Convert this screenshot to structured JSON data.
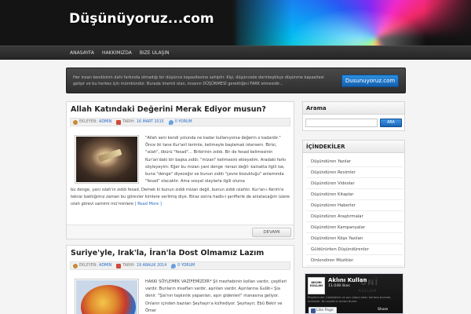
{
  "site": {
    "title": "Düşünüyoruz...com"
  },
  "nav": {
    "items": [
      "ANASAYFA",
      "HAKKIMIZDA",
      "BIZE ULAŞIN"
    ]
  },
  "infobar": {
    "text": "Her insan kendisinin dahi farkında olmadığı bir düşünce kapasitesine sahiptir. Kişi, düşüncede derinleştikçe düşünme kapasitesi gelişir ve bu herkes için mümkündür. Burada önemli olan, insanın DÜŞÜNMESİ gerektiğini FARK etmesidir...",
    "button": "Dusunuyoruz.com"
  },
  "posts": [
    {
      "title": "Allah Katındaki Değerini Merak Ediyor musun?",
      "meta": {
        "author_label": "EKLEYEN:",
        "author": "ADMIN",
        "date_label": "TARIH:",
        "date": "16 MART 2015",
        "comments": "0 YORUM"
      },
      "excerpt_right": "\"Allah seni kendi yolunda ne kadar kullanıyorsa değerin o kadardır.\" Önce iki tane Kur'anî terimle, kelimeyle başlamak istersem. Birisi, \"ıslah\", öbürü \"fesad\"… Birbirinin zıddı. Bir de fesad kelimesinin Kur'an'daki bir başka zıddı: \"mizan\" kelimesini ekleyelim. Aradaki farkı söyleyeyim: Eğer bu mizan yani denge -terazi değil- kainatta ilgili ise, buna \"denge\" diyeceğiz ve bunun zıddı \"çevre bozukluğu\" anlamında \"fesad\" olacaktır. Ama sosyal olaylarla ilgili olursa",
      "excerpt_bottom": "bu denge, yani ıslah'ın zıddı fesad. Demek ki bunun zıddı mizan değil, bunun zıddı ıslahtır. Kur'an-ı Kerim'e tekrar baktığımız zaman bu görevler kimlere verilmiş diye. Biraz sonra hadis-i şeriflerle de anlatacağım üzere ıslah görevi samimi mü'minlere",
      "more": "[ Read More ]",
      "button": "DEVAMI"
    },
    {
      "title": "Suriye'yle, Irak'la, İran'la Dost Olmamız Lazım",
      "meta": {
        "author_label": "EKLEYEN:",
        "author": "ADMIN",
        "date_label": "TARIH:",
        "date": "19 ARALIK 2014",
        "comments": "0 YORUM"
      },
      "excerpt_right": "HAKKI SÖYLEMEK VAZİFEMİZDİR* Şii mezhebinin kolları vardır, çeşitleri vardır. Bunların insafları vardır, aşırıları vardır. Aşırılarına Gulât-ı Şia denir. \"Şia'nın taşkınlık yapanları, aşırı gidenleri\" manasına geliyor. Onların içinden bazıları Şeyhayn'a küfrediyor. Şeyhayn; Ebû Bekir ve Ömer"
    }
  ],
  "sidebar": {
    "search": {
      "title": "Arama",
      "button": "ARA",
      "placeholder": ""
    },
    "toc": {
      "title": "İÇİNDEKİLER",
      "items": [
        "Düşündüren Yazılar",
        "Düşündüren Resimler",
        "Düşündüren Videolar",
        "Düşündüren Kitaplar",
        "Düşündüren Haberler",
        "Düşündüren Araştırmalar",
        "Düşündüren Kampanyalar",
        "Düşündüren Köşe Yazıları",
        "Güldürürken Düşündürenler",
        "Dinlendiren Müzikler"
      ]
    },
    "facebook": {
      "name": "Aklını Kullan",
      "likes": "11.048 likes",
      "avatar_text": "AKLINI KULLAN",
      "watermark": "ÜNİ",
      "watermark2": "KULLAN",
      "description": "Bilgilenmek, hakikatleri ve onu kabul eden herkesi bulmak, anlamak. Bu sayfanın amacı budur.",
      "like_button": "Like Page",
      "share": "Share"
    }
  },
  "colors": {
    "accent_blue": "#2a6ec8",
    "button_blue": "#1b66b8",
    "header_bg": "#141414"
  }
}
